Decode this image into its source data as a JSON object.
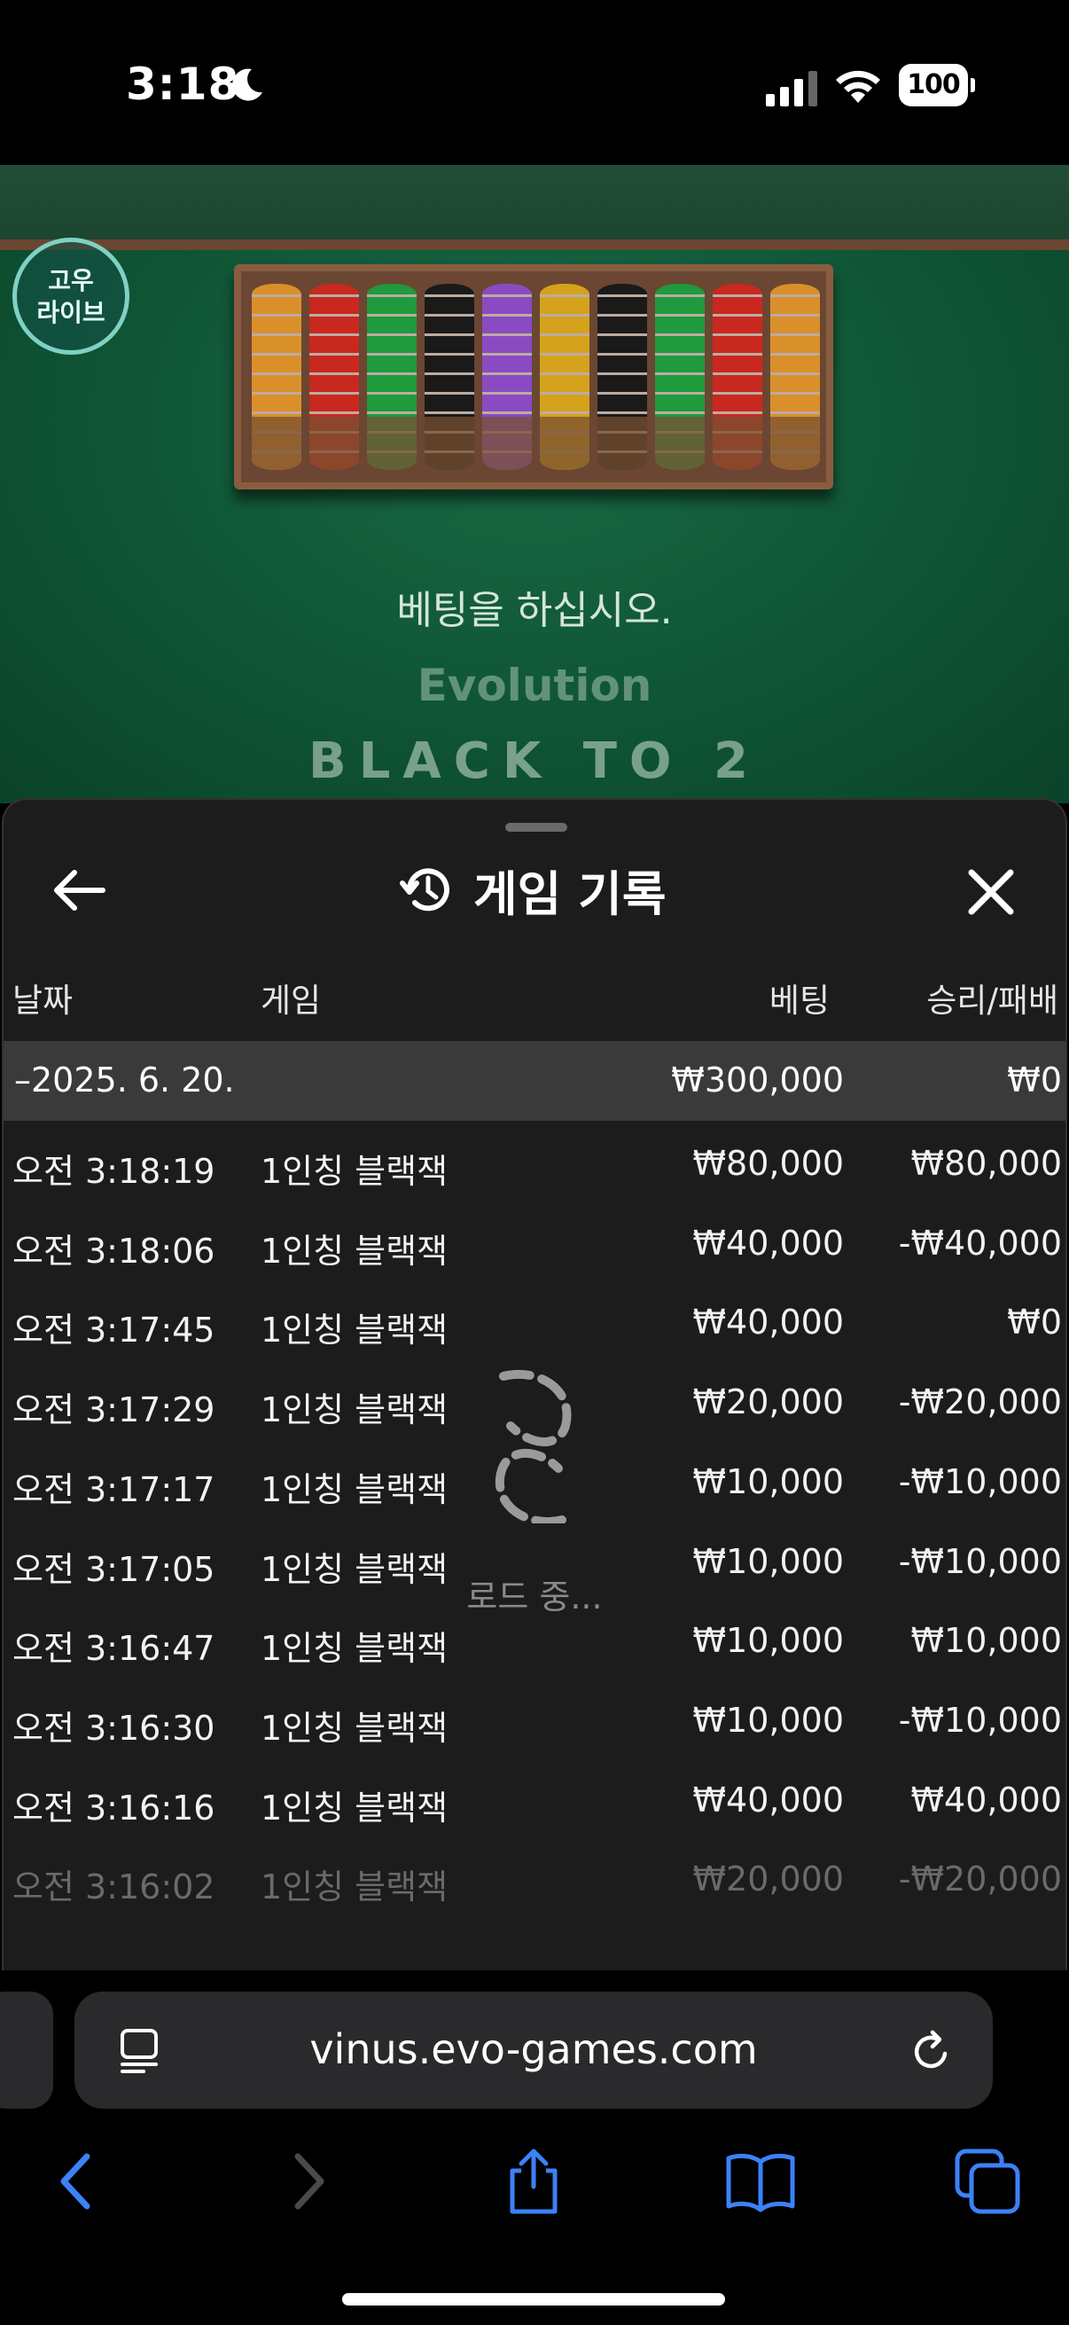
{
  "status_bar": {
    "time": "3:18",
    "battery": "100"
  },
  "game": {
    "logo_line1": "고우",
    "logo_line2": "라이브",
    "message": "베팅을 하십시오.",
    "provider": "Evolution",
    "table_text": "BLACK            TO 2",
    "chip_colors": [
      "#d9902a",
      "#c8281f",
      "#1f9a3c",
      "#1a1a1a",
      "#8a4bc2",
      "#d4a21b",
      "#1a1a1a",
      "#1f9a3c",
      "#c8281f",
      "#d9902a"
    ]
  },
  "history": {
    "title": "게임 기록",
    "columns": {
      "date": "날짜",
      "game": "게임",
      "bet": "베팅",
      "result": "승리/패배"
    },
    "date_group": {
      "date": "–2025. 6. 20.",
      "bet_total": "₩300,000",
      "result_total": "₩0"
    },
    "rows": [
      {
        "time": "오전 3:18:19",
        "game": "1인칭 블랙잭",
        "bet": "₩80,000",
        "result": "₩80,000"
      },
      {
        "time": "오전 3:18:06",
        "game": "1인칭 블랙잭",
        "bet": "₩40,000",
        "result": "-₩40,000"
      },
      {
        "time": "오전 3:17:45",
        "game": "1인칭 블랙잭",
        "bet": "₩40,000",
        "result": "₩0"
      },
      {
        "time": "오전 3:17:29",
        "game": "1인칭 블랙잭",
        "bet": "₩20,000",
        "result": "-₩20,000"
      },
      {
        "time": "오전 3:17:17",
        "game": "1인칭 블랙잭",
        "bet": "₩10,000",
        "result": "-₩10,000"
      },
      {
        "time": "오전 3:17:05",
        "game": "1인칭 블랙잭",
        "bet": "₩10,000",
        "result": "-₩10,000"
      },
      {
        "time": "오전 3:16:47",
        "game": "1인칭 블랙잭",
        "bet": "₩10,000",
        "result": "₩10,000"
      },
      {
        "time": "오전 3:16:30",
        "game": "1인칭 블랙잭",
        "bet": "₩10,000",
        "result": "-₩10,000"
      },
      {
        "time": "오전 3:16:16",
        "game": "1인칭 블랙잭",
        "bet": "₩40,000",
        "result": "₩40,000"
      },
      {
        "time": "오전 3:16:02",
        "game": "1인칭 블랙잭",
        "bet": "₩20,000",
        "result": "-₩20,000"
      }
    ],
    "loading_text": "로드 중..."
  },
  "browser": {
    "url": "vinus.evo-games.com",
    "accent": "#3b82f6"
  }
}
